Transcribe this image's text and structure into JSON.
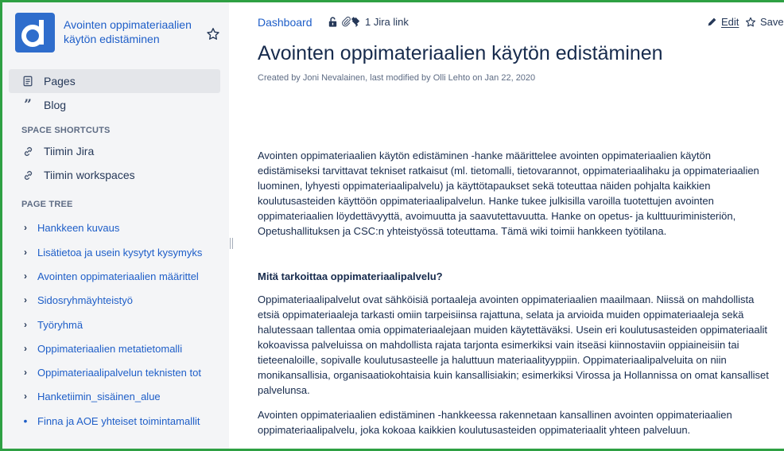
{
  "sidebar": {
    "space_title": "Avointen oppimateriaalien käytön edistäminen",
    "nav": [
      {
        "label": "Pages",
        "icon": "pages-icon"
      },
      {
        "label": "Blog",
        "icon": "blog-quote-icon"
      }
    ],
    "shortcuts_label": "SPACE SHORTCUTS",
    "shortcuts": [
      {
        "label": "Tiimin Jira",
        "icon": "link-icon"
      },
      {
        "label": "Tiimin workspaces",
        "icon": "link-icon"
      }
    ],
    "tree_label": "PAGE TREE",
    "tree": [
      {
        "label": "Hankkeen kuvaus",
        "marker": "›"
      },
      {
        "label": "Lisätietoa ja usein kysytyt kysymyks",
        "marker": "›"
      },
      {
        "label": "Avointen oppimateriaalien määrittel",
        "marker": "›"
      },
      {
        "label": "Sidosryhmäyhteistyö",
        "marker": "›"
      },
      {
        "label": "Työryhmä",
        "marker": "›"
      },
      {
        "label": "Oppimateriaalien metatietomalli",
        "marker": "›"
      },
      {
        "label": "Oppimateriaalipalvelun teknisten tot",
        "marker": "›"
      },
      {
        "label": "Hanketiimin_sisäinen_alue",
        "marker": "›"
      },
      {
        "label": "Finna ja AOE yhteiset toimintamallit",
        "marker": "•"
      }
    ]
  },
  "topbar": {
    "breadcrumb": "Dashboard",
    "jira_link": "1 Jira link",
    "edit": "Edit",
    "save": "Save"
  },
  "page": {
    "title": "Avointen oppimateriaalien käytön edistäminen",
    "byline": "Created by Joni Nevalainen, last modified by Olli Lehto on Jan 22, 2020",
    "intro": "Avointen oppimateriaalien käytön edistäminen -hanke määrittelee avointen oppimateriaalien käytön edistämiseksi tarvittavat tekniset ratkaisut (ml. tietomalli, tietovarannot, oppimateriaalihaku ja oppimateriaalien luominen, lyhyesti oppimateriaalipalvelu) ja käyttötapaukset sekä toteuttaa näiden pohjalta kaikkien koulutusasteiden käyttöön oppimateriaalipalvelun. Hanke tukee julkisilla varoilla tuotettujen avointen oppimateriaalien löydettävyyttä, avoimuutta ja saavutettavuutta. Hanke on opetus- ja kulttuuriministeriön, Opetushallituksen ja CSC:n yhteistyössä toteuttama. Tämä wiki toimii hankkeen työtilana.",
    "heading": "Mitä tarkoittaa oppimateriaalipalvelu?",
    "para2": "Oppimateriaalipalvelut ovat sähköisiä portaaleja avointen oppimateriaalien maailmaan. Niissä on mahdollista etsiä oppimateriaaleja tarkasti omiin tarpeisiinsa rajattuna, selata ja arvioida muiden oppimateriaaleja sekä halutessaan tallentaa omia oppimateriaalejaan muiden käytettäväksi. Usein eri koulutusasteiden oppimateriaalit kokoavissa palveluissa on mahdollista rajata tarjonta esimerkiksi vain itseäsi kiinnostaviin oppiaineisiin tai tieteenaloille, sopivalle koulutusasteelle ja haluttuun materiaalityyppiin. Oppimateriaalipalveluita on niin monikansallisia, organisaatiokohtaisia kuin kansallisiakin; esimerkiksi Virossa ja Hollannissa on omat kansalliset palvelunsa.",
    "para3": "Avointen oppimateriaalien edistäminen -hankkeessa rakennetaan kansallinen avointen oppimateriaalien oppimateriaalipalvelu, joka kokoaa kaikkien koulutusasteiden oppimateriaalit yhteen palveluun."
  },
  "colors": {
    "accent": "#2f6dcc",
    "link": "#1e5ec8",
    "frame": "#2ea043",
    "sidebar_bg": "#f4f5f7"
  }
}
